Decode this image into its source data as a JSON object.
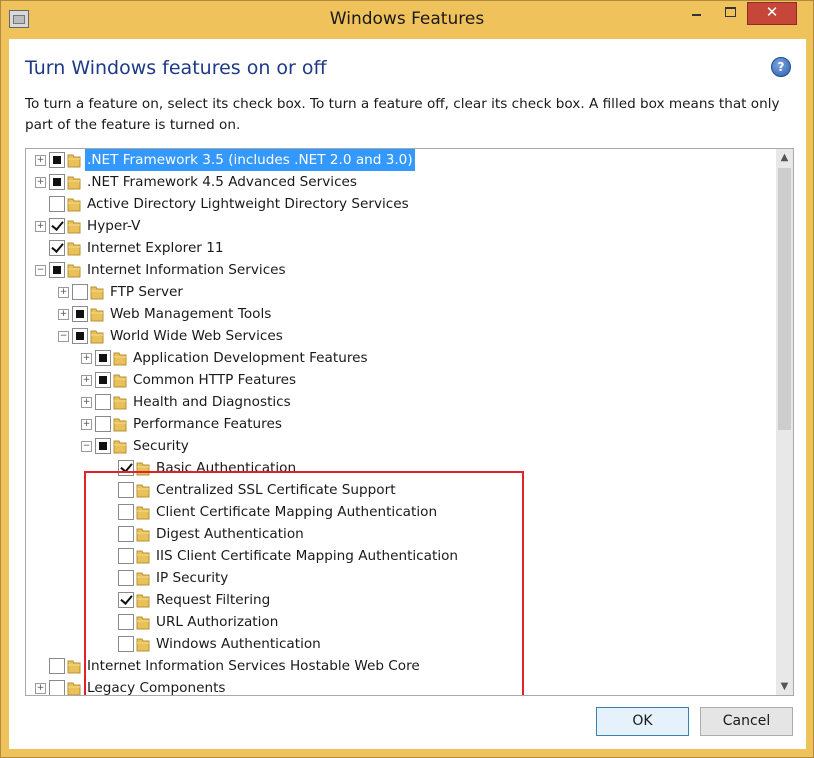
{
  "window": {
    "title": "Windows Features",
    "min_glyph": "",
    "close_glyph": "✕"
  },
  "heading": "Turn Windows features on or off",
  "help_glyph": "?",
  "description": "To turn a feature on, select its check box. To turn a feature off, clear its check box. A filled box means that only part of the feature is turned on.",
  "tree": {
    "items": [
      {
        "label": ".NET Framework 3.5 (includes .NET 2.0 and 3.0)",
        "level": 0,
        "expander": "+",
        "state": "partial",
        "selected": true
      },
      {
        "label": ".NET Framework 4.5 Advanced Services",
        "level": 0,
        "expander": "+",
        "state": "partial"
      },
      {
        "label": "Active Directory Lightweight Directory Services",
        "level": 0,
        "expander": "",
        "state": "unchecked"
      },
      {
        "label": "Hyper-V",
        "level": 0,
        "expander": "+",
        "state": "checked"
      },
      {
        "label": "Internet Explorer 11",
        "level": 0,
        "expander": "",
        "state": "checked"
      },
      {
        "label": "Internet Information Services",
        "level": 0,
        "expander": "−",
        "state": "partial"
      },
      {
        "label": "FTP Server",
        "level": 1,
        "expander": "+",
        "state": "unchecked"
      },
      {
        "label": "Web Management Tools",
        "level": 1,
        "expander": "+",
        "state": "partial"
      },
      {
        "label": "World Wide Web Services",
        "level": 1,
        "expander": "−",
        "state": "partial"
      },
      {
        "label": "Application Development Features",
        "level": 2,
        "expander": "+",
        "state": "partial"
      },
      {
        "label": "Common HTTP Features",
        "level": 2,
        "expander": "+",
        "state": "partial"
      },
      {
        "label": "Health and Diagnostics",
        "level": 2,
        "expander": "+",
        "state": "unchecked"
      },
      {
        "label": "Performance Features",
        "level": 2,
        "expander": "+",
        "state": "unchecked"
      },
      {
        "label": "Security",
        "level": 2,
        "expander": "−",
        "state": "partial"
      },
      {
        "label": "Basic Authentication",
        "level": 3,
        "expander": "",
        "state": "checked"
      },
      {
        "label": "Centralized SSL Certificate Support",
        "level": 3,
        "expander": "",
        "state": "unchecked"
      },
      {
        "label": "Client Certificate Mapping Authentication",
        "level": 3,
        "expander": "",
        "state": "unchecked"
      },
      {
        "label": "Digest Authentication",
        "level": 3,
        "expander": "",
        "state": "unchecked"
      },
      {
        "label": "IIS Client Certificate Mapping Authentication",
        "level": 3,
        "expander": "",
        "state": "unchecked"
      },
      {
        "label": "IP Security",
        "level": 3,
        "expander": "",
        "state": "unchecked"
      },
      {
        "label": "Request Filtering",
        "level": 3,
        "expander": "",
        "state": "checked"
      },
      {
        "label": "URL Authorization",
        "level": 3,
        "expander": "",
        "state": "unchecked"
      },
      {
        "label": "Windows Authentication",
        "level": 3,
        "expander": "",
        "state": "unchecked"
      },
      {
        "label": "Internet Information Services Hostable Web Core",
        "level": 0,
        "expander": "",
        "state": "unchecked"
      },
      {
        "label": "Legacy Components",
        "level": 0,
        "expander": "+",
        "state": "unchecked"
      }
    ]
  },
  "scrollbar": {
    "up_glyph": "▲",
    "down_glyph": "▼"
  },
  "buttons": {
    "ok": "OK",
    "cancel": "Cancel"
  },
  "colors": {
    "title_bg": "#f0c25c",
    "heading": "#1e3a87",
    "selection": "#3399ff",
    "highlight_box": "#e0222b",
    "close_button": "#c7463a"
  }
}
